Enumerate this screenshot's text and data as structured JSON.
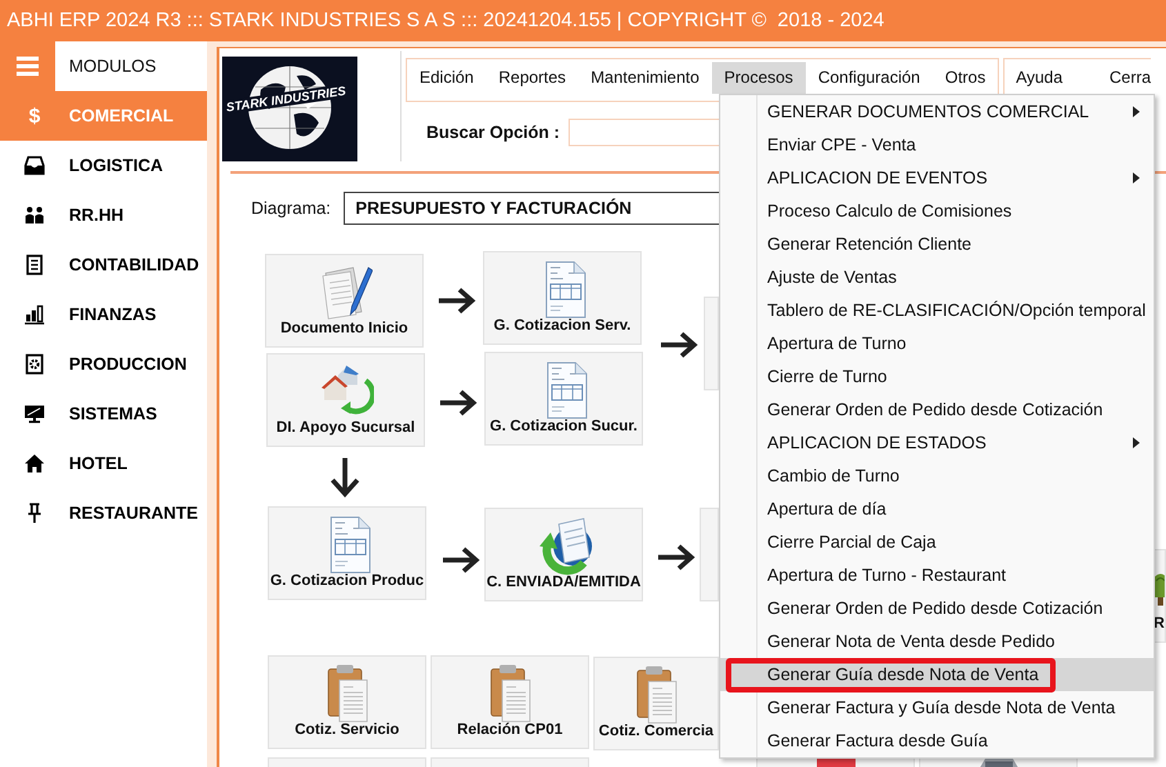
{
  "window": {
    "title": "ABHI ERP 2024 R3 ::: STARK INDUSTRIES S A S ::: 20241204.155 | COPYRIGHT ©  2018 - 2024"
  },
  "sidebar": {
    "header": "MODULOS",
    "items": [
      {
        "label": "COMERCIAL",
        "selected": true,
        "symbol": "$"
      },
      {
        "label": "LOGISTICA",
        "selected": false
      },
      {
        "label": "RR.HH",
        "selected": false
      },
      {
        "label": "CONTABILIDAD",
        "selected": false
      },
      {
        "label": "FINANZAS",
        "selected": false
      },
      {
        "label": "PRODUCCION",
        "selected": false
      },
      {
        "label": "SISTEMAS",
        "selected": false
      },
      {
        "label": "HOTEL",
        "selected": false
      },
      {
        "label": "RESTAURANTE",
        "selected": false
      }
    ]
  },
  "logo": {
    "text": "STARK INDUSTRIES"
  },
  "menubar": [
    {
      "label": "Edición",
      "selected": false
    },
    {
      "label": "Reportes",
      "selected": false
    },
    {
      "label": "Mantenimiento",
      "selected": false
    },
    {
      "label": "Procesos",
      "selected": true
    },
    {
      "label": "Configuración",
      "selected": false
    },
    {
      "label": "Otros",
      "selected": false
    }
  ],
  "menubar_right": [
    {
      "label": "Ayuda",
      "selected": false
    },
    {
      "label": "Cerra",
      "selected": false
    }
  ],
  "search": {
    "label": "Buscar Opción :"
  },
  "diagram": {
    "label": "Diagrama:",
    "value": "PRESUPUESTO Y FACTURACIÓN",
    "tiles": [
      {
        "kind": "pen",
        "label": "Documento Inicio"
      },
      {
        "kind": "invoice",
        "label": "G. Cotizacion Serv."
      },
      {
        "kind": "blank"
      },
      {
        "kind": "houses",
        "label": "DI. Apoyo Sucursal"
      },
      {
        "kind": "invoice",
        "label": "G. Cotizacion Sucur."
      },
      {
        "kind": "invoice",
        "label": "G. Cotizacion Produc"
      },
      {
        "kind": "refresh",
        "label": "C. ENVIADA/EMITIDA"
      },
      {
        "kind": "blank"
      },
      {
        "kind": "clipboard",
        "label": "Cotiz. Servicio"
      },
      {
        "kind": "clipboard",
        "label": "Relación CP01"
      },
      {
        "kind": "clipboard",
        "label": "Cotiz. Comercia"
      },
      {
        "kind": "blank"
      },
      {
        "kind": "blank"
      },
      {
        "kind": "box"
      },
      {
        "kind": "car"
      },
      {
        "kind": "plant",
        "label": "R"
      }
    ],
    "arrows": [
      {
        "kind": "right"
      },
      {
        "kind": "right"
      },
      {
        "kind": "right"
      },
      {
        "kind": "down"
      },
      {
        "kind": "right"
      },
      {
        "kind": "right"
      }
    ]
  },
  "procesos_menu": {
    "items": [
      {
        "label": "GENERAR DOCUMENTOS COMERCIAL",
        "kind": "submenu",
        "selected": false,
        "marked": false
      },
      {
        "label": "Enviar CPE - Venta",
        "kind": "action",
        "selected": false,
        "marked": false
      },
      {
        "label": "APLICACION DE EVENTOS",
        "kind": "submenu",
        "selected": false,
        "marked": false
      },
      {
        "label": "Proceso Calculo de Comisiones",
        "kind": "action",
        "selected": false,
        "marked": false
      },
      {
        "label": "Generar Retención Cliente",
        "kind": "action",
        "selected": false,
        "marked": false
      },
      {
        "label": "Ajuste de Ventas",
        "kind": "action",
        "selected": false,
        "marked": false
      },
      {
        "label": "Tablero de RE-CLASIFICACIÓN/Opción temporal",
        "kind": "action",
        "selected": false,
        "marked": false
      },
      {
        "label": "Apertura de Turno",
        "kind": "action",
        "selected": false,
        "marked": false
      },
      {
        "label": "Cierre de Turno",
        "kind": "action",
        "selected": false,
        "marked": false
      },
      {
        "label": "Generar Orden de Pedido desde Cotización",
        "kind": "action",
        "selected": false,
        "marked": false
      },
      {
        "label": "APLICACION DE ESTADOS",
        "kind": "submenu",
        "selected": false,
        "marked": false
      },
      {
        "label": "Cambio de Turno",
        "kind": "action",
        "selected": false,
        "marked": false
      },
      {
        "label": "Apertura de día",
        "kind": "action",
        "selected": false,
        "marked": false
      },
      {
        "label": "Cierre Parcial de Caja",
        "kind": "action",
        "selected": false,
        "marked": false
      },
      {
        "label": "Apertura de Turno - Restaurant",
        "kind": "action",
        "selected": false,
        "marked": false
      },
      {
        "label": "Generar Orden de Pedido desde Cotización",
        "kind": "action",
        "selected": false,
        "marked": false
      },
      {
        "label": "Generar Nota de Venta desde Pedido",
        "kind": "action",
        "selected": false,
        "marked": false
      },
      {
        "label": "Generar Guía desde Nota de Venta",
        "kind": "action",
        "selected": true,
        "marked": true
      },
      {
        "label": "Generar Factura y Guía desde Nota de Venta",
        "kind": "action",
        "selected": false,
        "marked": false
      },
      {
        "label": "Generar Factura desde Guía",
        "kind": "action",
        "selected": false,
        "marked": false
      }
    ]
  }
}
